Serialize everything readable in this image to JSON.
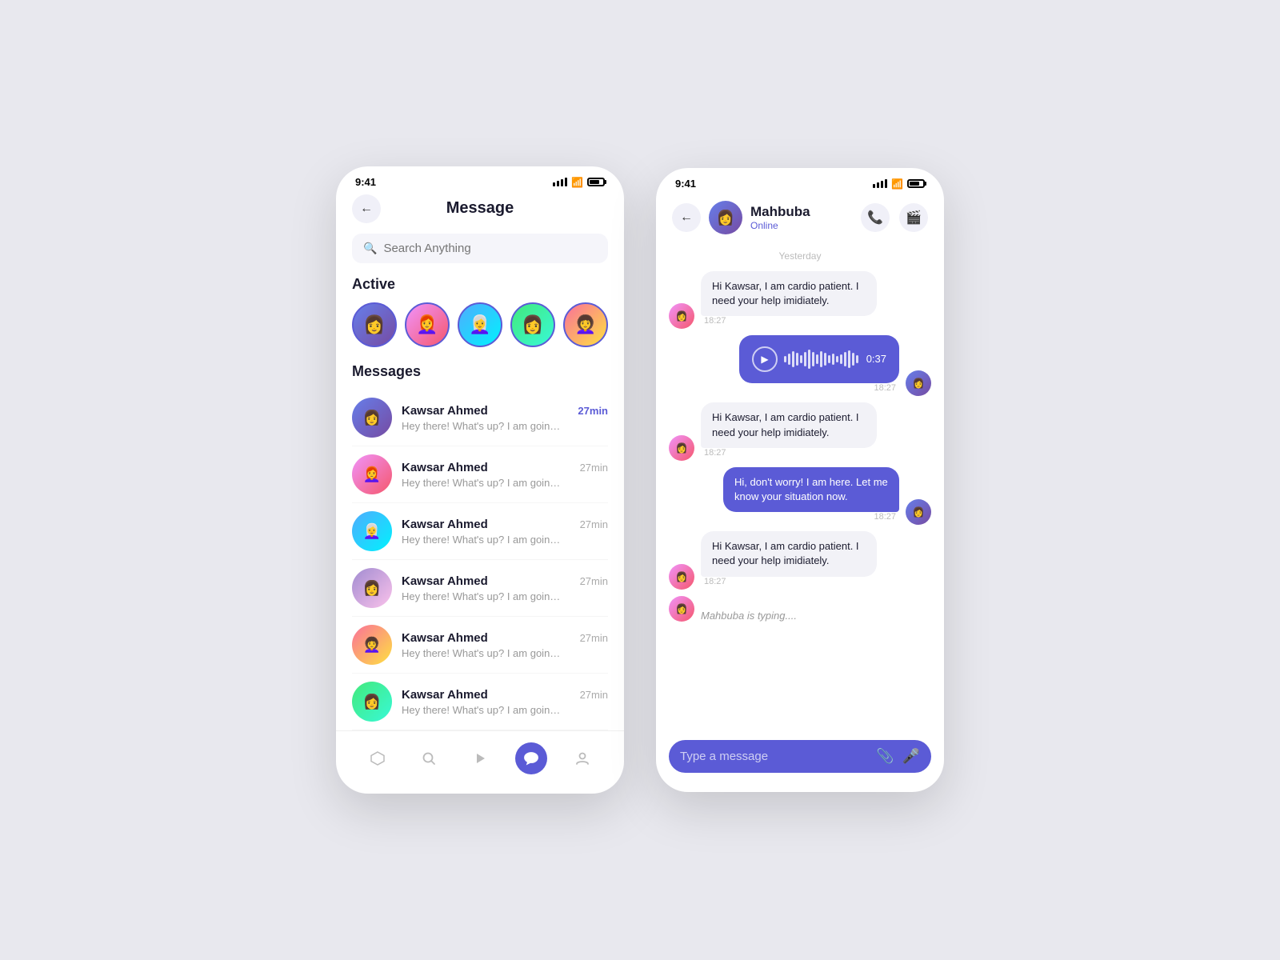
{
  "phone1": {
    "statusBar": {
      "time": "9:41"
    },
    "header": {
      "title": "Message",
      "backLabel": "←"
    },
    "search": {
      "placeholder": "Search Anything"
    },
    "activeSection": {
      "label": "Active"
    },
    "activeUsers": [
      {
        "id": 1,
        "colorClass": "av1",
        "icon": "👩"
      },
      {
        "id": 2,
        "colorClass": "av2",
        "icon": "👩‍🦰"
      },
      {
        "id": 3,
        "colorClass": "av3",
        "icon": "👩‍🦳"
      },
      {
        "id": 4,
        "colorClass": "av4",
        "icon": "👩"
      },
      {
        "id": 5,
        "colorClass": "av5",
        "icon": "👩‍🦱"
      }
    ],
    "messagesSection": {
      "label": "Messages"
    },
    "messages": [
      {
        "name": "Kawsar Ahmed",
        "time": "27min",
        "preview": "Hey there! What's up? I am going....",
        "active": true,
        "colorClass": "av1",
        "icon": "👩"
      },
      {
        "name": "Kawsar Ahmed",
        "time": "27min",
        "preview": "Hey there! What's up? I am going....",
        "active": false,
        "colorClass": "av2",
        "icon": "👩‍🦰"
      },
      {
        "name": "Kawsar Ahmed",
        "time": "27min",
        "preview": "Hey there! What's up? I am going....",
        "active": false,
        "colorClass": "av3",
        "icon": "👩‍🦳"
      },
      {
        "name": "Kawsar Ahmed",
        "time": "27min",
        "preview": "Hey there! What's up? I am going....",
        "active": false,
        "colorClass": "av6",
        "icon": "👩"
      },
      {
        "name": "Kawsar Ahmed",
        "time": "27min",
        "preview": "Hey there! What's up? I am going....",
        "active": false,
        "colorClass": "av5",
        "icon": "👩‍🦱"
      },
      {
        "name": "Kawsar Ahmed",
        "time": "27min",
        "preview": "Hey there! What's up? I am going....",
        "active": false,
        "colorClass": "av4",
        "icon": "👩"
      }
    ],
    "bottomNav": [
      {
        "icon": "⬡",
        "label": "home",
        "active": false
      },
      {
        "icon": "🔍",
        "label": "search",
        "active": false
      },
      {
        "icon": "▶",
        "label": "play",
        "active": false
      },
      {
        "icon": "💬",
        "label": "chat",
        "active": true
      },
      {
        "icon": "👤",
        "label": "profile",
        "active": false
      }
    ]
  },
  "phone2": {
    "statusBar": {
      "time": "9:41"
    },
    "header": {
      "backLabel": "←",
      "userName": "Mahbuba",
      "userStatus": "Online",
      "callIcon": "📞",
      "videoIcon": "📹"
    },
    "dateDivider": "Yesterday",
    "messages": [
      {
        "type": "received",
        "text": "Hi Kawsar, I am cardio patient. I need your help imidiately.",
        "time": "18:27"
      },
      {
        "type": "voice",
        "duration": "0:37",
        "time": "18:27"
      },
      {
        "type": "received",
        "text": "Hi Kawsar, I am cardio patient. I need your help imidiately.",
        "time": "18:27"
      },
      {
        "type": "sent",
        "text": "Hi, don't worry! I am here. Let me know your situation now.",
        "time": "18:27"
      },
      {
        "type": "received",
        "text": "Hi Kawsar, I am cardio patient. I need your help imidiately.",
        "time": "18:27"
      },
      {
        "type": "typing",
        "text": "Mahbuba is typing...."
      }
    ],
    "input": {
      "placeholder": "Type a message"
    },
    "waveHeights": [
      8,
      14,
      20,
      16,
      10,
      18,
      24,
      18,
      12,
      20,
      16,
      10,
      14,
      8,
      12,
      18,
      22,
      16,
      10
    ]
  }
}
